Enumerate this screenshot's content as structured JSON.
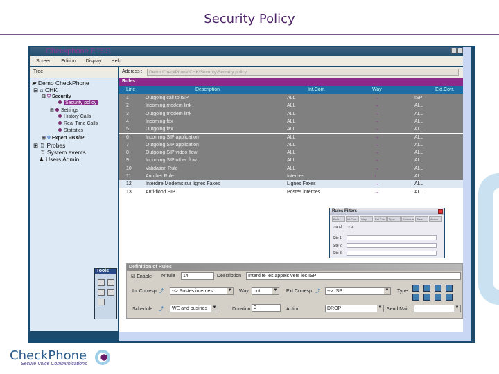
{
  "slide_title": "Security Policy",
  "app": {
    "title": "Checkphone ETSS",
    "menu": [
      "Screen",
      "Edition",
      "Display",
      "Help"
    ]
  },
  "tree": {
    "header": "Tree",
    "root": "Demo CheckPhone",
    "chk": "CHK",
    "security": "Security",
    "items": [
      "Security policy",
      "Settings",
      "History Calls",
      "Real Time Calls",
      "Statistics"
    ],
    "expert": "Expert PBX/IP",
    "probes": "Probes",
    "system": "System events",
    "users": "Users Admin."
  },
  "address": {
    "label": "Address :",
    "value": "Demo CheckPhone\\CHK\\Security\\Security policy"
  },
  "rules": {
    "title": "Rules",
    "columns": [
      "Line",
      "Description",
      "Int.Corr.",
      "Way",
      "Ext.Corr."
    ],
    "rows": [
      [
        "1",
        "Outgoing call to ISP",
        "ALL",
        "→",
        "ISP"
      ],
      [
        "2",
        "Incoming modem link",
        "ALL",
        "→",
        "ALL"
      ],
      [
        "3",
        "Outgoing modem link",
        "ALL",
        "→",
        "ALL"
      ],
      [
        "4",
        "Incoming fax",
        "ALL",
        "→",
        "ALL"
      ],
      [
        "5",
        "Outgoing fax",
        "ALL",
        "→",
        "ALL"
      ],
      [
        "6",
        "Incoming SIP application",
        "ALL",
        "→",
        "ALL"
      ],
      [
        "7",
        "Outgoing SIP application",
        "ALL",
        "→",
        "ALL"
      ],
      [
        "8",
        "Outgoing SIP video flow",
        "ALL",
        "→",
        "ALL"
      ],
      [
        "9",
        "Incoming SIP other flow",
        "ALL",
        "→",
        "ALL"
      ],
      [
        "10",
        "Validation Rule",
        "ALL",
        "→",
        "ALL"
      ],
      [
        "11",
        "Another Rule",
        "Internes",
        "↓",
        "ALL"
      ],
      [
        "12",
        "Interdire Modems sur lignes Faxes",
        "Lignes Faxes",
        "→",
        "ALL"
      ],
      [
        "13",
        "Anti-flood SIP",
        "Postes internes",
        "→",
        "ALL"
      ]
    ]
  },
  "filter": {
    "title": "Rules Filters",
    "tabs": [
      "Rule",
      "Int Corr",
      "Way",
      "Ext Corr",
      "Type",
      "Schedule",
      "Time",
      "Action"
    ],
    "and": "and",
    "or": "or",
    "sites": [
      "Site 1",
      "Site 2",
      "Site 3"
    ]
  },
  "definition": {
    "title": "Definition of Rules",
    "enable": "Enable",
    "nrule_label": "N°rule",
    "nrule": "14",
    "desc_label": "Description",
    "desc": "Interdire les appels vers les ISP",
    "int_label": "Int.Corresp.",
    "int": "--> Postes internes",
    "way_label": "Way",
    "way": "out",
    "ext_label": "Ext.Corresp.",
    "ext": "--> ISP",
    "type_label": "Type",
    "sched_label": "Schedule",
    "sched": "WE and busines",
    "dur_label": "Duration",
    "dur": "0",
    "action_label": "Action",
    "action": "DROP",
    "mail_label": "Send Mail",
    "mail": ""
  },
  "tools": {
    "title": "Tools"
  },
  "logo": {
    "name": "CheckPhone",
    "tagline": "Secure Voice Communications"
  }
}
